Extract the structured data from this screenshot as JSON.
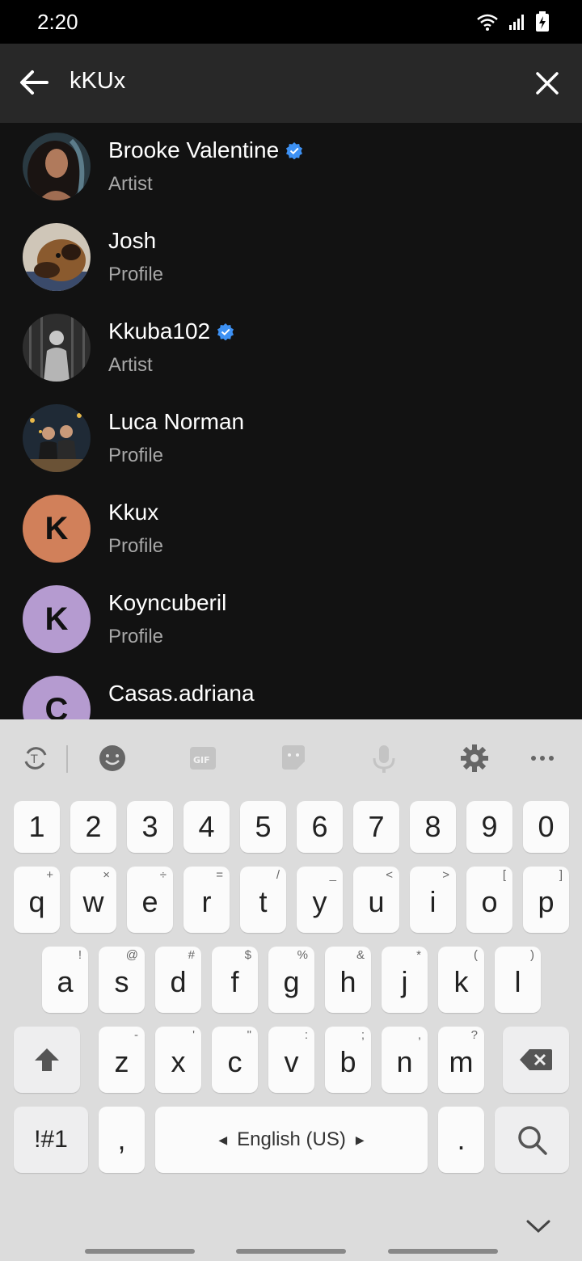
{
  "status": {
    "time": "2:20"
  },
  "search": {
    "query": "kKUx"
  },
  "results": [
    {
      "name": "Brooke Valentine",
      "sub": "Artist",
      "verified": true,
      "avatar": "photo"
    },
    {
      "name": "Josh",
      "sub": "Profile",
      "verified": false,
      "avatar": "photo"
    },
    {
      "name": "Kkuba102",
      "sub": "Artist",
      "verified": true,
      "avatar": "photo"
    },
    {
      "name": "Luca Norman",
      "sub": "Profile",
      "verified": false,
      "avatar": "photo"
    },
    {
      "name": "Kkux",
      "sub": "Profile",
      "verified": false,
      "avatar_letter": "K",
      "avatar_color": "#d1805a"
    },
    {
      "name": "Koyncuberil",
      "sub": "Profile",
      "verified": false,
      "avatar_letter": "K",
      "avatar_color": "#b59bd0"
    },
    {
      "name": "Casas.adriana",
      "sub": "",
      "verified": false,
      "avatar_letter": "C",
      "avatar_color": "#b59bd0"
    }
  ],
  "keyboard": {
    "numbers": [
      "1",
      "2",
      "3",
      "4",
      "5",
      "6",
      "7",
      "8",
      "9",
      "0"
    ],
    "row1": [
      {
        "k": "q",
        "h": "+"
      },
      {
        "k": "w",
        "h": "×"
      },
      {
        "k": "e",
        "h": "÷"
      },
      {
        "k": "r",
        "h": "="
      },
      {
        "k": "t",
        "h": "/"
      },
      {
        "k": "y",
        "h": "_"
      },
      {
        "k": "u",
        "h": "<"
      },
      {
        "k": "i",
        "h": ">"
      },
      {
        "k": "o",
        "h": "["
      },
      {
        "k": "p",
        "h": "]"
      }
    ],
    "row2": [
      {
        "k": "a",
        "h": "!"
      },
      {
        "k": "s",
        "h": "@"
      },
      {
        "k": "d",
        "h": "#"
      },
      {
        "k": "f",
        "h": "$"
      },
      {
        "k": "g",
        "h": "%"
      },
      {
        "k": "h",
        "h": "&"
      },
      {
        "k": "j",
        "h": "*"
      },
      {
        "k": "k",
        "h": "("
      },
      {
        "k": "l",
        "h": ")"
      }
    ],
    "row3": [
      {
        "k": "z",
        "h": "-"
      },
      {
        "k": "x",
        "h": "'"
      },
      {
        "k": "c",
        "h": "\""
      },
      {
        "k": "v",
        "h": ":"
      },
      {
        "k": "b",
        "h": ";"
      },
      {
        "k": "n",
        "h": ","
      },
      {
        "k": "m",
        "h": "?"
      }
    ],
    "symbols_label": "!#1",
    "comma": ",",
    "space_label": "English (US)",
    "period": "."
  },
  "colors": {
    "verified": "#3d91f4",
    "keyboard_bg": "#dcdcdc",
    "header_bg": "#282828"
  }
}
